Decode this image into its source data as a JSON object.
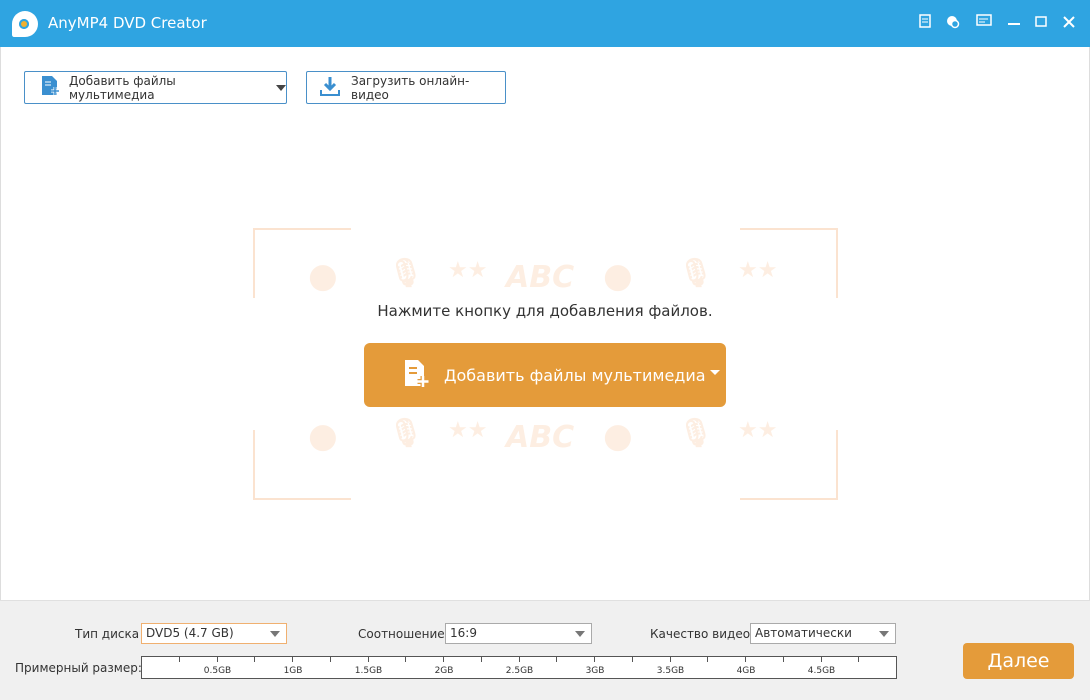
{
  "window": {
    "title": "AnyMP4 DVD Creator"
  },
  "toolbar": {
    "add_media_label": "Добавить файлы мультимедиа",
    "download_online_label": "Загрузить онлайн-видео"
  },
  "main": {
    "hint": "Нажмите кнопку для добавления файлов.",
    "add_media_label": "Добавить файлы мультимедиа",
    "watermark_text": "ABC"
  },
  "bottom": {
    "disc_type_label": "Тип диска",
    "disc_type_value": "DVD5 (4.7 GB)",
    "ratio_label": "Соотношение:",
    "ratio_value": "16:9",
    "quality_label": "Качество видео:",
    "quality_value": "Автоматически",
    "size_label": "Примерный размер:",
    "ruler_labels": [
      "0.5GB",
      "1GB",
      "1.5GB",
      "2GB",
      "2.5GB",
      "3GB",
      "3.5GB",
      "4GB",
      "4.5GB"
    ],
    "estimated_size_gb": 0,
    "next_label": "Далее"
  },
  "colors": {
    "titlebar": "#2fa4e1",
    "accent": "#e49b3a"
  }
}
